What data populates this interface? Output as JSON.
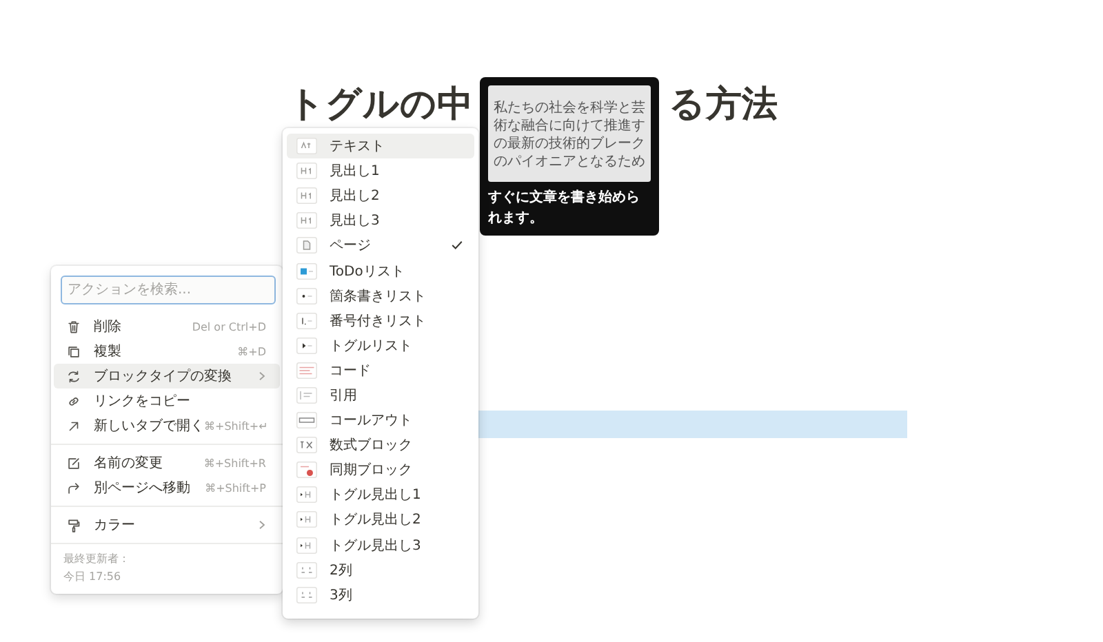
{
  "title_parts": [
    "トグルの中",
    "る方法"
  ],
  "selected_block": {
    "highlighted": true
  },
  "tooltip": {
    "preview_lines": [
      "私たちの社会を科学と芸",
      "術な融合に向けて推進す",
      "の最新の技術的ブレーク",
      "のパイオニアとなるため"
    ],
    "caption": "すぐに文章を書き始められます。"
  },
  "action_menu": {
    "search": {
      "placeholder": "アクションを検索..."
    },
    "sections": [
      [
        {
          "kind": "trash",
          "label": "削除",
          "shortcut": "Del or Ctrl+D",
          "submenu": false,
          "selected": false
        },
        {
          "kind": "duplicate",
          "label": "複製",
          "shortcut": "⌘+D",
          "submenu": false,
          "selected": false
        },
        {
          "kind": "convert",
          "label": "ブロックタイプの変換",
          "submenu": true,
          "selected": true
        },
        {
          "kind": "link",
          "label": "リンクをコピー",
          "submenu": false,
          "selected": false
        },
        {
          "kind": "newtab",
          "label": "新しいタブで開く",
          "shortcut": "⌘+Shift+↵",
          "submenu": false,
          "selected": false
        }
      ],
      [
        {
          "kind": "rename",
          "label": "名前の変更",
          "shortcut": "⌘+Shift+R",
          "submenu": false,
          "selected": false
        },
        {
          "kind": "move",
          "label": "別ページへ移動",
          "shortcut": "⌘+Shift+P",
          "submenu": false,
          "selected": false
        }
      ],
      [
        {
          "kind": "color",
          "label": "カラー",
          "submenu": true,
          "selected": false
        }
      ]
    ],
    "footer": {
      "label": "最終更新者：",
      "time": "今日 17:56"
    }
  },
  "turn_into_menu": [
    {
      "kind": "text",
      "label": "テキスト",
      "selected": true,
      "checked": false
    },
    {
      "kind": "h1",
      "label": "見出し1",
      "selected": false,
      "checked": false
    },
    {
      "kind": "h2",
      "label": "見出し2",
      "selected": false,
      "checked": false
    },
    {
      "kind": "h3",
      "label": "見出し3",
      "selected": false,
      "checked": false
    },
    {
      "kind": "page",
      "label": "ページ",
      "selected": false,
      "checked": true
    },
    {
      "kind": "todo",
      "label": "ToDoリスト",
      "selected": false,
      "checked": false
    },
    {
      "kind": "bullet",
      "label": "箇条書きリスト",
      "selected": false,
      "checked": false
    },
    {
      "kind": "number",
      "label": "番号付きリスト",
      "selected": false,
      "checked": false
    },
    {
      "kind": "toggle",
      "label": "トグルリスト",
      "selected": false,
      "checked": false
    },
    {
      "kind": "code",
      "label": "コード",
      "selected": false,
      "checked": false
    },
    {
      "kind": "quote",
      "label": "引用",
      "selected": false,
      "checked": false
    },
    {
      "kind": "callout",
      "label": "コールアウト",
      "selected": false,
      "checked": false
    },
    {
      "kind": "math",
      "label": "数式ブロック",
      "selected": false,
      "checked": false
    },
    {
      "kind": "sync",
      "label": "同期ブロック",
      "selected": false,
      "checked": false
    },
    {
      "kind": "toggleh",
      "label": "トグル見出し1",
      "selected": false,
      "checked": false
    },
    {
      "kind": "toggleh",
      "label": "トグル見出し2",
      "selected": false,
      "checked": false
    },
    {
      "kind": "toggleh",
      "label": "トグル見出し3",
      "selected": false,
      "checked": false
    },
    {
      "kind": "columns",
      "label": "2列",
      "selected": false,
      "checked": false
    },
    {
      "kind": "columns",
      "label": "3列",
      "selected": false,
      "checked": false
    }
  ]
}
